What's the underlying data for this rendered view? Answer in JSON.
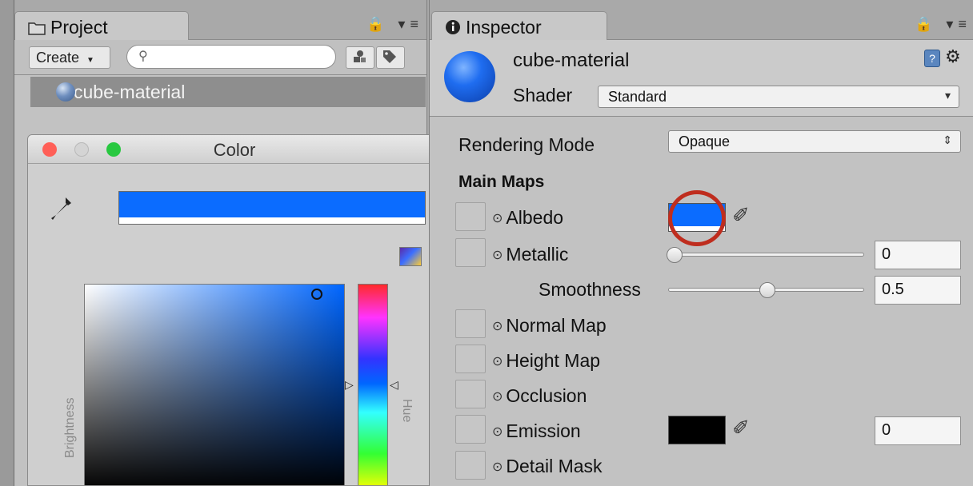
{
  "project": {
    "tab_label": "Project",
    "create_label": "Create",
    "create_arrow": "▼",
    "search_placeholder": "",
    "search_glyph": "⚲",
    "tab_tools": "🔒 ▾≡",
    "asset_name": "cube-material"
  },
  "color_picker": {
    "title": "Color",
    "brightness_label": "Brightness",
    "hue_label": "Hue",
    "current_color": "#0b6cff",
    "eyedropper_glyph": "✐",
    "tl_close": "#ff5f57",
    "tl_min": "#cfcfcf",
    "tl_max": "#28c840"
  },
  "inspector": {
    "tab_label": "Inspector",
    "tab_icon": "ℹ",
    "material_name": "cube-material",
    "shader_label": "Shader",
    "shader_value": "Standard",
    "dd_arrow": "▾",
    "dd_spin": "⇕",
    "help_glyph": "?",
    "gear_glyph": "⚙",
    "rendering_mode_label": "Rendering Mode",
    "rendering_mode_value": "Opaque",
    "main_maps_label": "Main Maps",
    "dot": "⊙",
    "albedo_label": "Albedo",
    "albedo_color": "#0b6cff",
    "metallic_label": "Metallic",
    "metallic_value": "0",
    "metallic_level": 0.0,
    "smoothness_label": "Smoothness",
    "smoothness_value": "0.5",
    "smoothness_level": 0.5,
    "normal_map_label": "Normal Map",
    "height_map_label": "Height Map",
    "occlusion_label": "Occlusion",
    "emission_label": "Emission",
    "emission_color": "#000000",
    "emission_value": "0",
    "detail_mask_label": "Detail Mask",
    "eyedropper_glyph": "✐"
  }
}
